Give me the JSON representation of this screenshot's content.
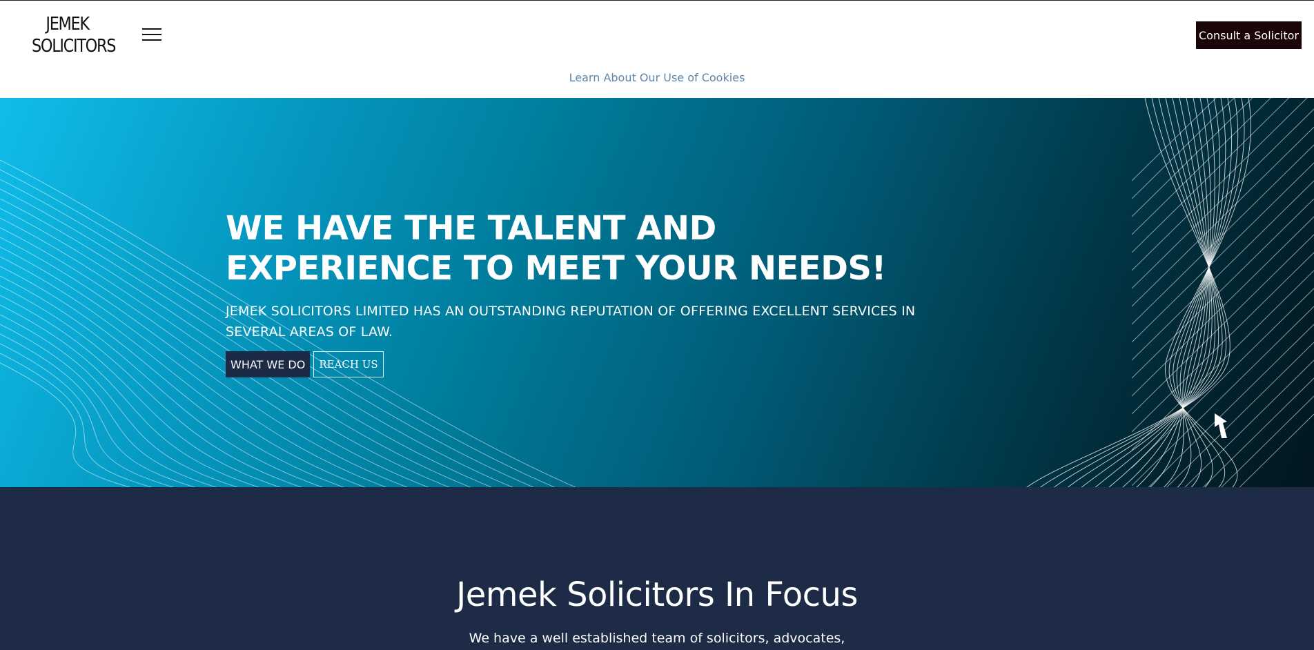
{
  "header": {
    "logo_line1": "JEMEK",
    "logo_line2": "SOLICITORS",
    "menu_icon": "hamburger-menu-icon",
    "consult_label": "Consult a Solicitor",
    "cookie_link": "Learn About Our Use of Cookies"
  },
  "hero": {
    "title": "WE HAVE THE TALENT AND EXPERIENCE TO MEET YOUR NEEDS!",
    "subtitle": "JEMEK SOLICITORS LIMITED HAS AN OUTSTANDING REPUTATION OF OFFERING EXCELLENT SERVICES IN SEVERAL AREAS OF LAW.",
    "primary_button": "WHAT WE DO",
    "secondary_button": "REACH US"
  },
  "focus": {
    "title": "Jemek Solicitors In Focus",
    "text": "We have a well established team of solicitors, advocates,"
  },
  "colors": {
    "consult_button_bg": "#1a0508",
    "cookie_link": "#5e86a9",
    "hero_gradient_start": "#10bde9",
    "hero_gradient_end": "#02161e",
    "section_bg": "#1d2b46",
    "primary_button_bg": "#1d2a46"
  }
}
